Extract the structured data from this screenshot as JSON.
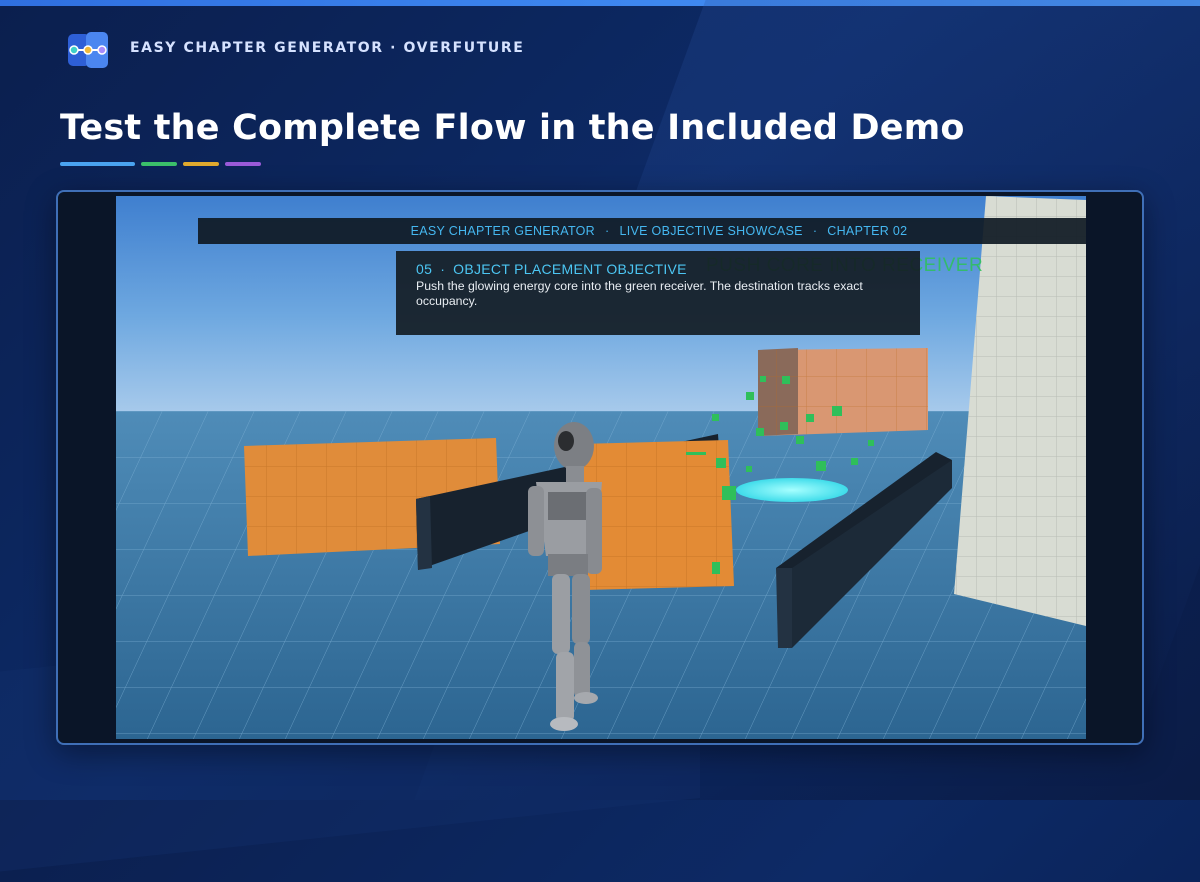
{
  "brand": {
    "name": "EASY CHAPTER GENERATOR · OVERFUTURE"
  },
  "page": {
    "title": "Test the Complete Flow in the Included Demo"
  },
  "colors": {
    "accent_blue": "#4aa3f0",
    "accent_green": "#3bbf6a",
    "accent_yellow": "#e0a92e",
    "accent_purple": "#9a5ad9"
  },
  "icons": {
    "logo": "chapter-nodes-logo-icon"
  },
  "hud": {
    "items": [
      "EASY CHAPTER GENERATOR",
      "LIVE OBJECTIVE SHOWCASE",
      "CHAPTER 02"
    ],
    "separator": "·"
  },
  "objective": {
    "number": "05",
    "separator": "·",
    "title": "OBJECT PLACEMENT OBJECTIVE",
    "description": "Push the glowing energy core into the green receiver. The destination tracks exact occupancy."
  },
  "world_label": "PUSH CORE INTO RECEIVER"
}
